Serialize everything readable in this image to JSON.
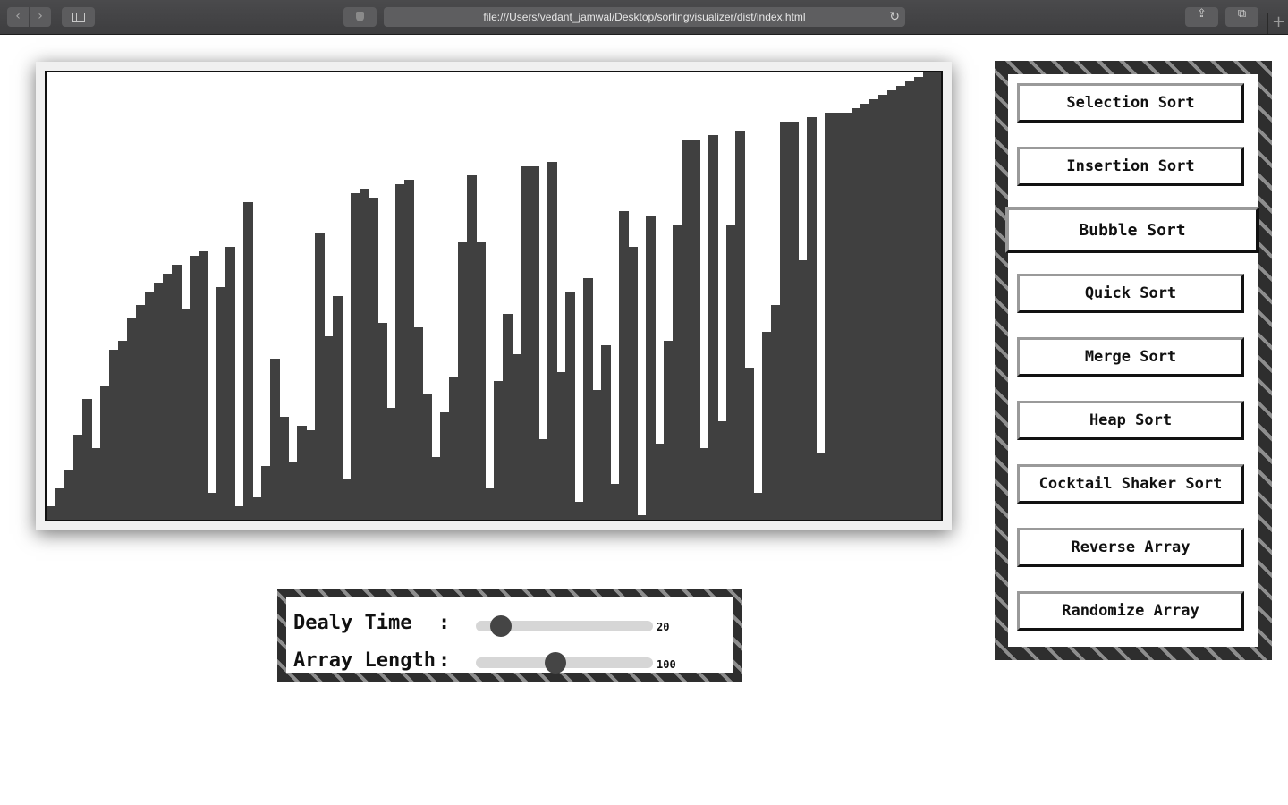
{
  "browser": {
    "url": "file:///Users/vedant_jamwal/Desktop/sortingvisualizer/dist/index.html",
    "back_icon": "‹",
    "forward_icon": "›",
    "reload_icon": "↻",
    "share_icon": "⇪",
    "tabs_icon": "⧉",
    "new_tab_icon": "+"
  },
  "controls": {
    "delay": {
      "label": "Dealy Time",
      "colon": ":",
      "value": "20",
      "fraction": 0.14
    },
    "length": {
      "label": "Array Length",
      "colon": ":",
      "value": "100",
      "fraction": 0.45
    }
  },
  "algorithms": [
    {
      "label": "Selection Sort"
    },
    {
      "label": "Insertion Sort"
    },
    {
      "label": "Bubble Sort",
      "active": true
    },
    {
      "label": "Quick Sort"
    },
    {
      "label": "Merge Sort"
    },
    {
      "label": "Heap Sort"
    },
    {
      "label": "Cocktail Shaker Sort"
    },
    {
      "label": "Reverse Array"
    },
    {
      "label": "Randomize Array"
    }
  ],
  "array_values": [
    15,
    35,
    55,
    95,
    135,
    80,
    150,
    190,
    200,
    225,
    240,
    255,
    265,
    275,
    285,
    235,
    295,
    300,
    30,
    260,
    305,
    15,
    355,
    25,
    60,
    180,
    115,
    65,
    105,
    100,
    320,
    205,
    250,
    45,
    365,
    370,
    360,
    220,
    125,
    375,
    380,
    215,
    140,
    70,
    120,
    160,
    310,
    385,
    310,
    35,
    155,
    230,
    185,
    395,
    395,
    90,
    400,
    165,
    255,
    20,
    270,
    145,
    195,
    40,
    345,
    305,
    5,
    340,
    85,
    200,
    330,
    425,
    425,
    80,
    430,
    110,
    330,
    435,
    170,
    30,
    210,
    240,
    445,
    445,
    290,
    450,
    75,
    455,
    455,
    455,
    460,
    465,
    470,
    475,
    480,
    485,
    490,
    495,
    500,
    500
  ],
  "colors": {
    "bar": "#404040",
    "hatch_dark": "#2e2e2e",
    "hatch_light": "#8e8e8e"
  }
}
